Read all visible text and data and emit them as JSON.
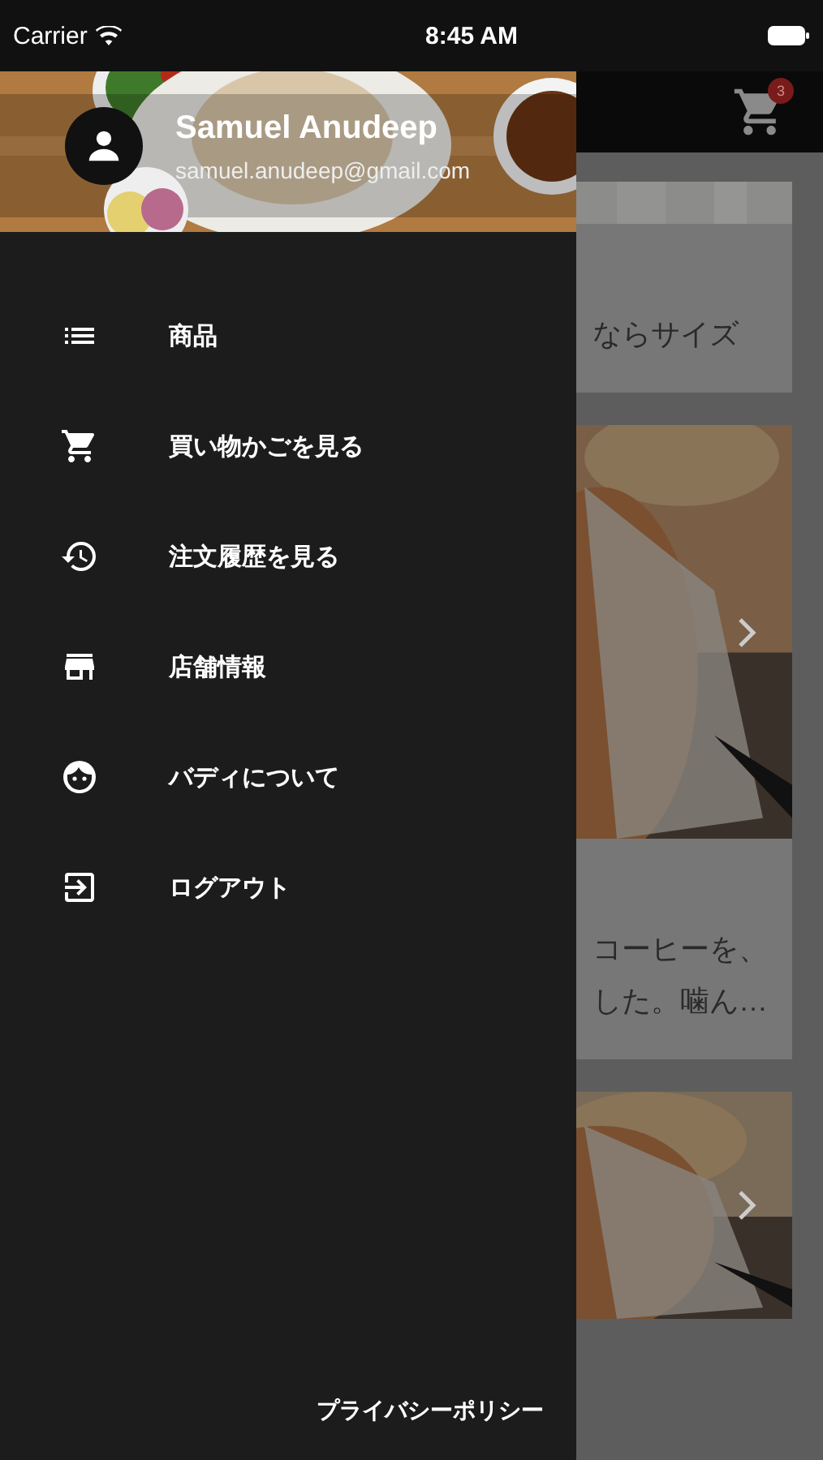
{
  "status_bar": {
    "carrier": "Carrier",
    "time": "8:45 AM"
  },
  "drawer": {
    "user": {
      "name": "Samuel Anudeep",
      "email": "samuel.anudeep@gmail.com"
    },
    "menu": [
      {
        "label": "商品"
      },
      {
        "label": "買い物かごを見る"
      },
      {
        "label": "注文履歴を見る"
      },
      {
        "label": "店舗情報"
      },
      {
        "label": "バディについて"
      },
      {
        "label": "ログアウト"
      }
    ],
    "footer_link": "プライバシーポリシー"
  },
  "navbar": {
    "cart_count": "3"
  },
  "content": {
    "cards": [
      {
        "lines": [
          "ならサイズ"
        ]
      },
      {
        "lines": [
          "コーヒーを、",
          "した。噛ん…"
        ]
      }
    ]
  }
}
